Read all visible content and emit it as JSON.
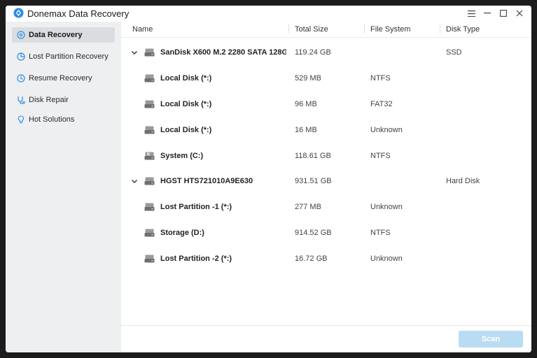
{
  "app": {
    "title": "Donemax Data Recovery",
    "accent": "#2d8ce6"
  },
  "sidebar": {
    "items": [
      {
        "label": "Data Recovery",
        "icon": "disc-icon",
        "active": true
      },
      {
        "label": "Lost Partition Recovery",
        "icon": "pie-chart-icon",
        "active": false
      },
      {
        "label": "Resume Recovery",
        "icon": "clock-icon",
        "active": false
      },
      {
        "label": "Disk Repair",
        "icon": "stethoscope-icon",
        "active": false
      },
      {
        "label": "Hot Solutions",
        "icon": "lightbulb-icon",
        "active": false
      }
    ]
  },
  "table": {
    "columns": [
      "Name",
      "Total Size",
      "File System",
      "Disk Type"
    ],
    "rows": [
      {
        "name": "SanDisk X600 M.2 2280 SATA 128GB",
        "size": "119.24 GB",
        "fs": "",
        "type": "SSD",
        "disk": true
      },
      {
        "name": "Local Disk (*:)",
        "size": "529 MB",
        "fs": "NTFS",
        "type": "",
        "disk": false
      },
      {
        "name": "Local Disk (*:)",
        "size": "96 MB",
        "fs": "FAT32",
        "type": "",
        "disk": false
      },
      {
        "name": "Local Disk (*:)",
        "size": "16 MB",
        "fs": "Unknown",
        "type": "",
        "disk": false
      },
      {
        "name": "System (C:)",
        "size": "118.61 GB",
        "fs": "NTFS",
        "type": "",
        "disk": false,
        "windows": true
      },
      {
        "name": "HGST HTS721010A9E630",
        "size": "931.51 GB",
        "fs": "",
        "type": "Hard Disk",
        "disk": true
      },
      {
        "name": "Lost Partition -1 (*:)",
        "size": "277 MB",
        "fs": "Unknown",
        "type": "",
        "disk": false
      },
      {
        "name": "Storage (D:)",
        "size": "914.52 GB",
        "fs": "NTFS",
        "type": "",
        "disk": false
      },
      {
        "name": "Lost Partition -2 (*:)",
        "size": "16.72 GB",
        "fs": "Unknown",
        "type": "",
        "disk": false
      }
    ]
  },
  "footer": {
    "scan_label": "Scan"
  }
}
